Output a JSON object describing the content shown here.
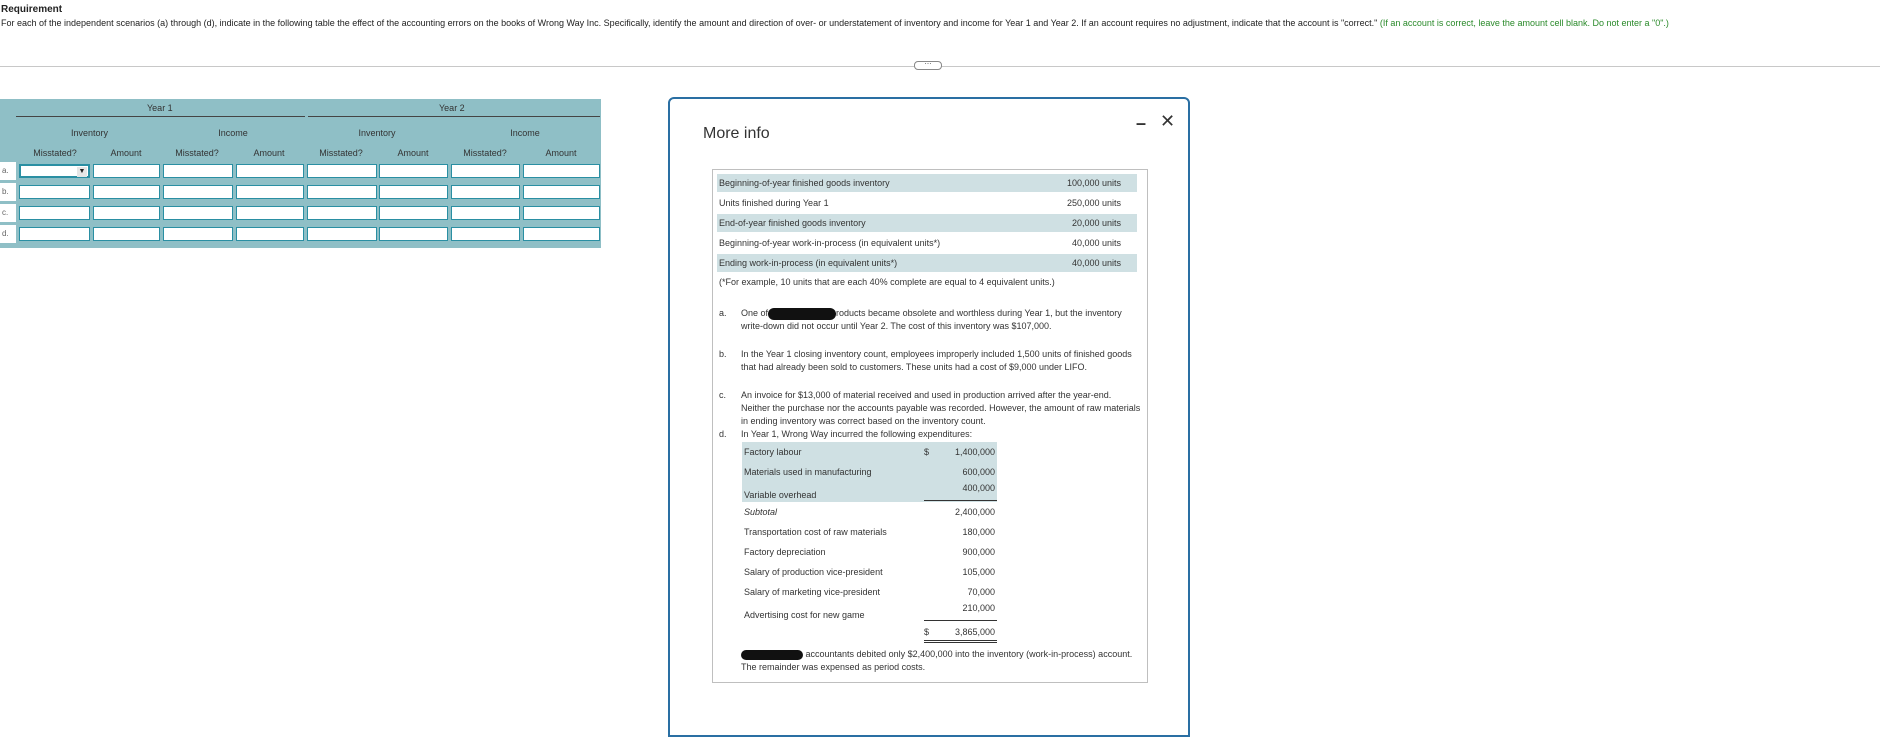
{
  "requirement": {
    "title": "Requirement",
    "text": "For each of the independent scenarios (a) through (d), indicate in the following table the effect of the accounting errors on the books of Wrong Way Inc. Specifically, identify the amount and direction of over- or understatement of inventory and income for Year 1 and Year 2. If an account requires no adjustment, indicate that the account is \"correct.\"",
    "hint": "(If an account is correct, leave the amount cell blank. Do not enter a \"0\".)"
  },
  "drag_handle": "⋯",
  "table": {
    "years": [
      "Year 1",
      "Year 2"
    ],
    "groups": [
      "Inventory",
      "Income",
      "Inventory",
      "Income"
    ],
    "columns": [
      "Misstated?",
      "Amount",
      "Misstated?",
      "Amount",
      "Misstated?",
      "Amount",
      "Misstated?",
      "Amount"
    ],
    "rows": [
      "a.",
      "b.",
      "c.",
      "d."
    ]
  },
  "popup": {
    "title": "More info",
    "minimize": "–",
    "close": "✕",
    "facts": [
      {
        "label": "Beginning-of-year finished goods inventory",
        "value": "100,000 units"
      },
      {
        "label": "Units finished during Year 1",
        "value": "250,000 units"
      },
      {
        "label": "End-of-year finished goods inventory",
        "value": "20,000 units"
      },
      {
        "label": "Beginning-of-year work-in-process (in equivalent units*)",
        "value": "40,000 units"
      },
      {
        "label": "Ending work-in-process (in equivalent units*)",
        "value": "40,000 units"
      }
    ],
    "footnote": "(*For example, 10 units that are each 40% complete are equal to 4 equivalent units.)",
    "items": [
      {
        "letter": "a.",
        "pre": "One of",
        "post": "roducts became obsolete and worthless during Year 1, but the inventory write-down did not occur until Year 2. The cost of this inventory was $107,000."
      },
      {
        "letter": "b.",
        "text": "In the Year 1 closing inventory count, employees improperly included 1,500 units of finished goods that had already been sold to customers. These units had a cost of $9,000 under LIFO."
      },
      {
        "letter": "c.",
        "text": "An invoice for $13,000 of material received and used in production arrived after the year-end. Neither the purchase nor the accounts payable was recorded. However, the amount of raw materials in ending inventory was correct based on the inventory count."
      },
      {
        "letter": "d.",
        "text": "In Year 1, Wrong Way incurred the following expenditures:"
      }
    ],
    "expenditures": [
      {
        "label": "Factory labour",
        "currency": "$",
        "value": "1,400,000"
      },
      {
        "label": "Materials used in manufacturing",
        "value": "600,000"
      },
      {
        "label": "Variable overhead",
        "value": "400,000"
      },
      {
        "label": "Subtotal",
        "value": "2,400,000"
      },
      {
        "label": "Transportation cost of raw materials",
        "value": "180,000"
      },
      {
        "label": "Factory depreciation",
        "value": "900,000"
      },
      {
        "label": "Salary of production vice-president",
        "value": "105,000"
      },
      {
        "label": "Salary of marketing vice-president",
        "value": "70,000"
      },
      {
        "label": "Advertising cost for new game",
        "value": "210,000"
      },
      {
        "label": "",
        "currency": "$",
        "value": "3,865,000"
      }
    ],
    "closing": "accountants debited only $2,400,000 into the inventory (work-in-process) account. The remainder was expensed as period costs."
  }
}
